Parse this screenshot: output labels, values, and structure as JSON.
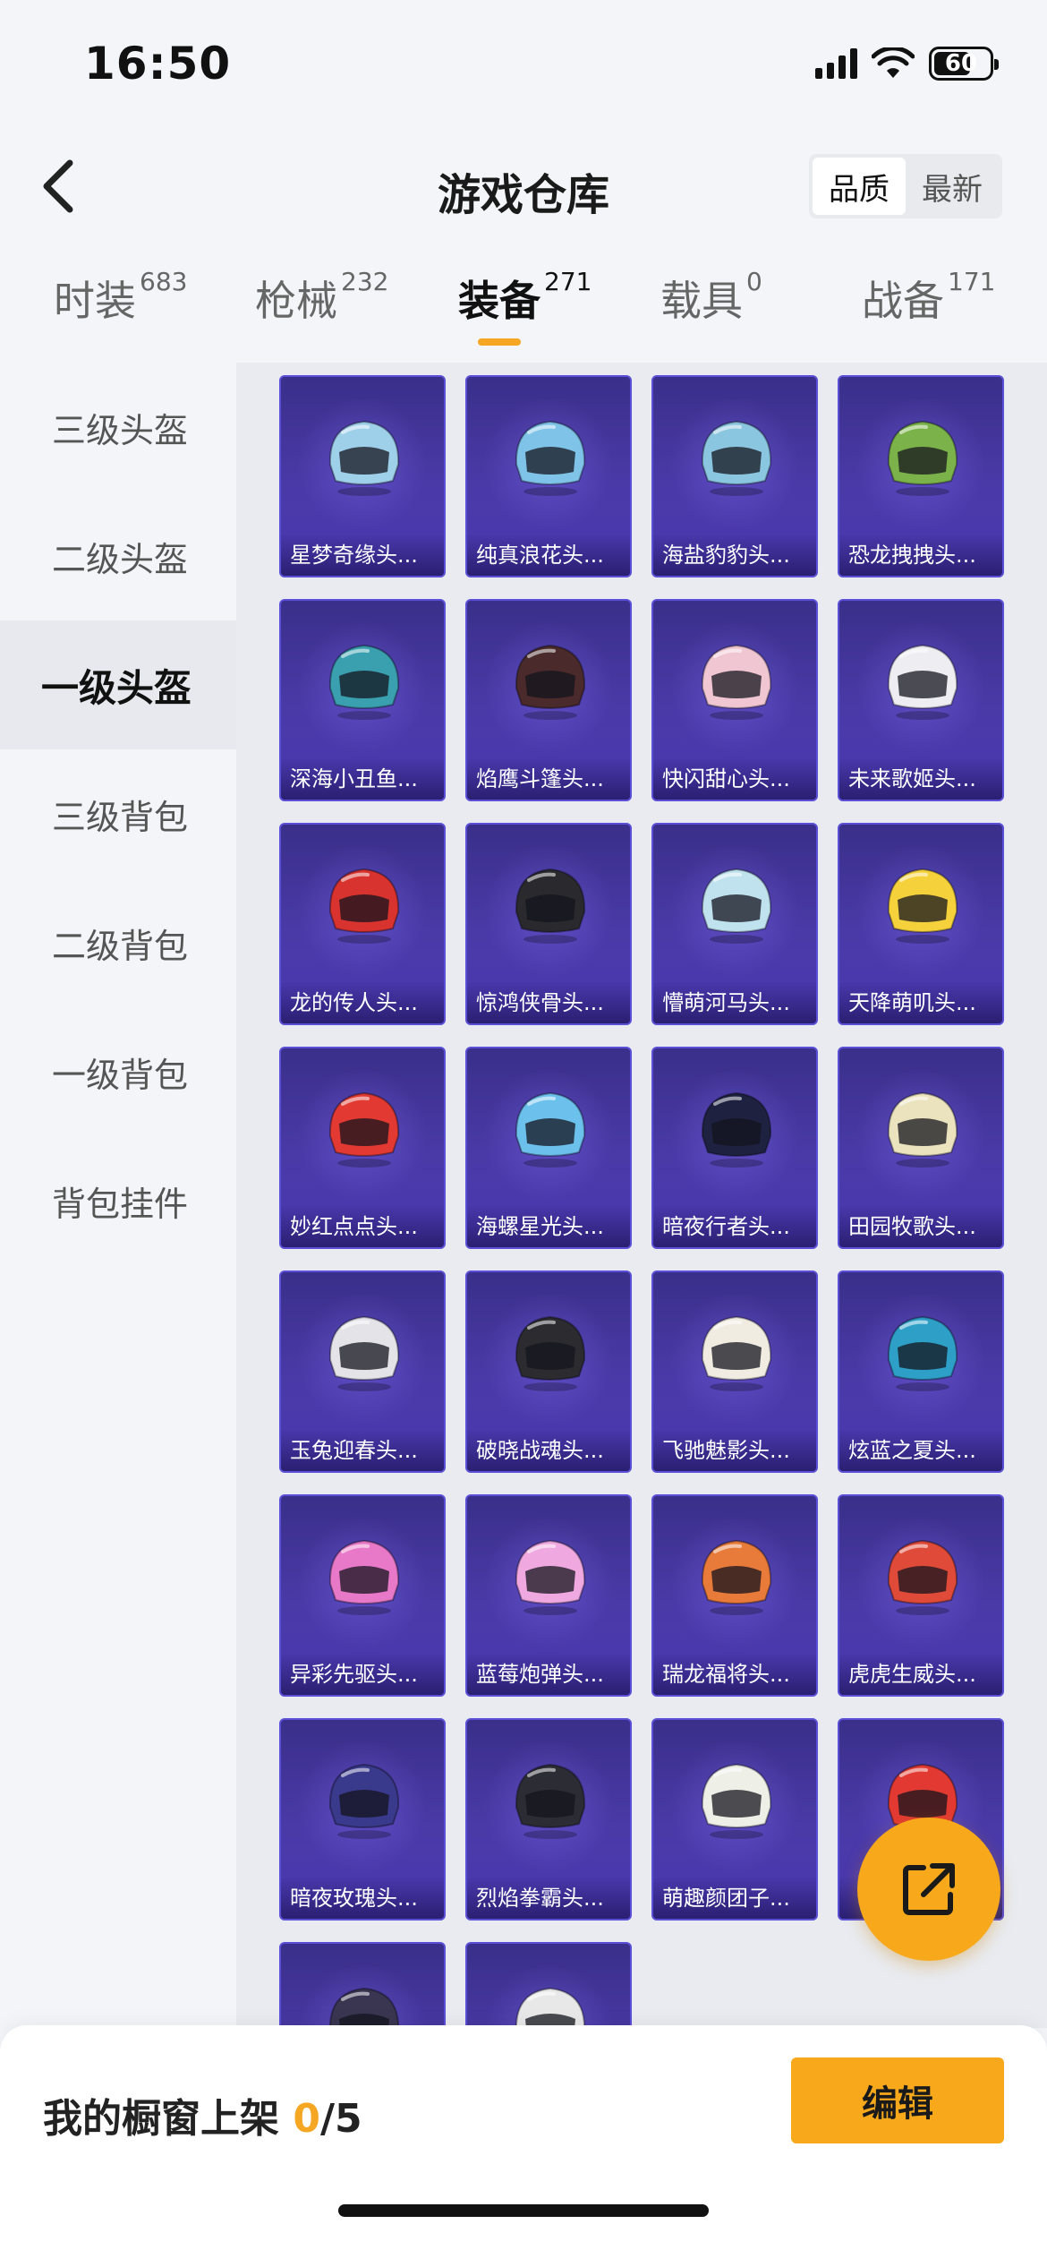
{
  "status_bar": {
    "time": "16:50",
    "battery": "60"
  },
  "header": {
    "title": "游戏仓库",
    "sort_options": [
      "品质",
      "最新"
    ],
    "sort_active": 0
  },
  "tabs": [
    {
      "label": "时装",
      "count": "683"
    },
    {
      "label": "枪械",
      "count": "232"
    },
    {
      "label": "装备",
      "count": "271"
    },
    {
      "label": "载具",
      "count": "0"
    },
    {
      "label": "战备",
      "count": "171"
    }
  ],
  "active_tab": 2,
  "sidebar": {
    "items": [
      "三级头盔",
      "二级头盔",
      "一级头盔",
      "三级背包",
      "二级背包",
      "一级背包",
      "背包挂件"
    ],
    "active": 2
  },
  "items": [
    {
      "name": "星梦奇缘头...",
      "color": "#9fd0ea"
    },
    {
      "name": "纯真浪花头...",
      "color": "#7fc4e8"
    },
    {
      "name": "海盐豹豹头...",
      "color": "#8ac6e0"
    },
    {
      "name": "恐龙拽拽头...",
      "color": "#7bb34a"
    },
    {
      "name": "深海小丑鱼...",
      "color": "#3aa0b0"
    },
    {
      "name": "焰鹰斗篷头...",
      "color": "#4a2a2a"
    },
    {
      "name": "快闪甜心头...",
      "color": "#f0c6d2"
    },
    {
      "name": "未来歌姬头...",
      "color": "#eeeef2"
    },
    {
      "name": "龙的传人头...",
      "color": "#d8332e"
    },
    {
      "name": "惊鸿侠骨头...",
      "color": "#2a2a2e"
    },
    {
      "name": "懵萌河马头...",
      "color": "#bfe2ee"
    },
    {
      "name": "天降萌叽头...",
      "color": "#f5d23c"
    },
    {
      "name": "妙红点点头...",
      "color": "#e23a32"
    },
    {
      "name": "海螺星光头...",
      "color": "#6cc0ec"
    },
    {
      "name": "暗夜行者头...",
      "color": "#1e2240"
    },
    {
      "name": "田园牧歌头...",
      "color": "#ebe3bd"
    },
    {
      "name": "玉兔迎春头...",
      "color": "#e4e4e8"
    },
    {
      "name": "破晓战魂头...",
      "color": "#2c2c30"
    },
    {
      "name": "飞驰魅影头...",
      "color": "#f0ece2"
    },
    {
      "name": "炫蓝之夏头...",
      "color": "#2ea0c8"
    },
    {
      "name": "异彩先驱头...",
      "color": "#e878c8"
    },
    {
      "name": "蓝莓炮弹头...",
      "color": "#f0a8e0"
    },
    {
      "name": "瑞龙福将头...",
      "color": "#e87a3a"
    },
    {
      "name": "虎虎生威头...",
      "color": "#e04a38"
    },
    {
      "name": "暗夜玫瑰头...",
      "color": "#3a3a8c"
    },
    {
      "name": "烈焰拳霸头...",
      "color": "#2c2c34"
    },
    {
      "name": "萌趣颜团子...",
      "color": "#eef0e8"
    },
    {
      "name": "",
      "color": "#e23a32"
    },
    {
      "name": "",
      "color": "#3a3550"
    },
    {
      "name": "",
      "color": "#e8e8e8"
    }
  ],
  "bottom": {
    "showcase_label": "我的橱窗上架",
    "showcase_current": "0",
    "showcase_total": "/5",
    "edit_label": "编辑"
  }
}
